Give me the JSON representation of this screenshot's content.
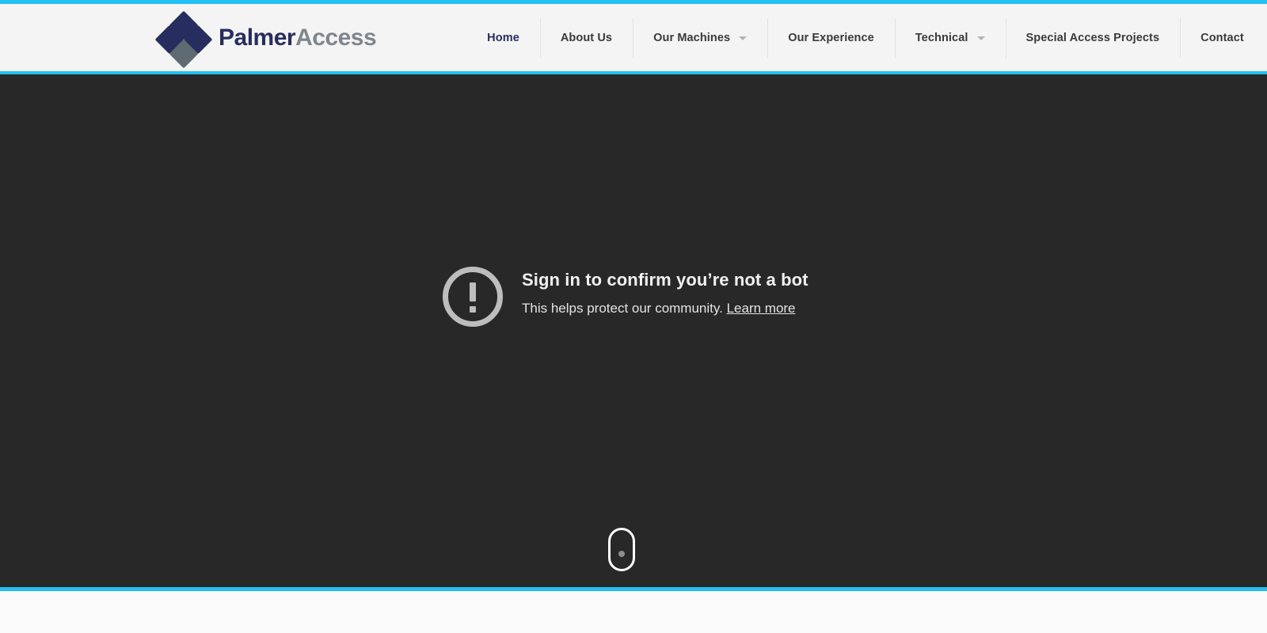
{
  "theme": {
    "accent_cyan": "#22c0f4",
    "header_bg": "#f4f4f4",
    "hero_bg": "#282828",
    "brand_navy": "#282d60",
    "brand_gray": "#7f868d",
    "page_bg": "#fbfbfb"
  },
  "header": {
    "logo": {
      "mark_icon": "four-diamonds-icon",
      "text_primary": "Palmer",
      "text_secondary": "Access"
    },
    "nav": [
      {
        "label": "Home",
        "active": true,
        "has_dropdown": false
      },
      {
        "label": "About Us",
        "active": false,
        "has_dropdown": false
      },
      {
        "label": "Our Machines",
        "active": false,
        "has_dropdown": true
      },
      {
        "label": "Our Experience",
        "active": false,
        "has_dropdown": false
      },
      {
        "label": "Technical",
        "active": false,
        "has_dropdown": true
      },
      {
        "label": "Special Access Projects",
        "active": false,
        "has_dropdown": false
      },
      {
        "label": "Contact",
        "active": false,
        "has_dropdown": false
      }
    ]
  },
  "hero": {
    "notice": {
      "icon": "exclamation-circle-icon",
      "title": "Sign in to confirm you’re not a bot",
      "subtitle": "This helps protect our community.",
      "link_label": "Learn more"
    },
    "scroll_indicator": {
      "icon": "mouse-scroll-icon"
    }
  }
}
